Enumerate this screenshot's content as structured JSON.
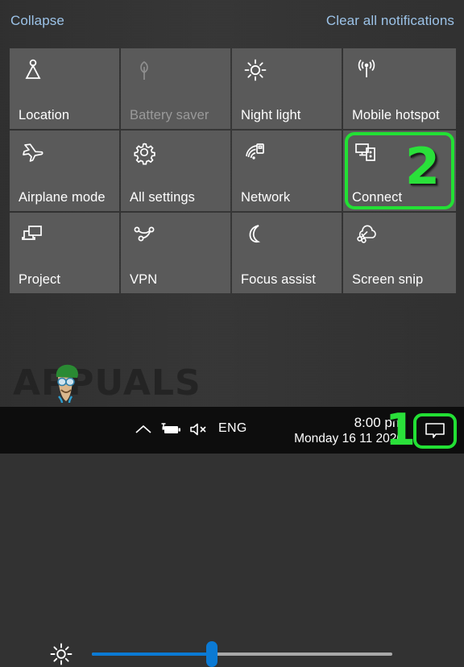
{
  "panel": {
    "collapse_label": "Collapse",
    "clear_label": "Clear all notifications",
    "link_color": "#9cc3e8",
    "background_color": "#323232",
    "tile_color": "#5a5a5a"
  },
  "tiles": [
    {
      "label": "Location",
      "icon": "location-icon",
      "enabled": true
    },
    {
      "label": "Battery saver",
      "icon": "leaf-icon",
      "enabled": false
    },
    {
      "label": "Night light",
      "icon": "sun-icon",
      "enabled": true
    },
    {
      "label": "Mobile hotspot",
      "icon": "hotspot-icon",
      "enabled": true
    },
    {
      "label": "Airplane mode",
      "icon": "airplane-icon",
      "enabled": true
    },
    {
      "label": "All settings",
      "icon": "gear-icon",
      "enabled": true
    },
    {
      "label": "Network",
      "icon": "network-icon",
      "enabled": true
    },
    {
      "label": "Connect",
      "icon": "connect-icon",
      "enabled": true,
      "highlighted": true
    },
    {
      "label": "Project",
      "icon": "project-icon",
      "enabled": true
    },
    {
      "label": "VPN",
      "icon": "vpn-icon",
      "enabled": true
    },
    {
      "label": "Focus assist",
      "icon": "moon-icon",
      "enabled": true
    },
    {
      "label": "Screen snip",
      "icon": "scissors-cloud-icon",
      "enabled": true
    }
  ],
  "brightness": {
    "icon": "brightness-sun-icon",
    "value_percent": 40,
    "fill_color": "#0b7ad4",
    "track_color": "#a9a9a9"
  },
  "annotations": {
    "step_1": "1",
    "step_2": "2",
    "highlight_color": "#22e034"
  },
  "watermark": {
    "text": "APPUALS"
  },
  "taskbar": {
    "chevron_icon": "chevron-up-icon",
    "battery_icon": "battery-charging-icon",
    "volume_icon": "speaker-muted-icon",
    "language": "ENG",
    "time": "8:00 pm",
    "date": "Monday 16 11 2020",
    "action_center_icon": "notification-bubble-icon",
    "background_color": "#0d0d0d"
  }
}
